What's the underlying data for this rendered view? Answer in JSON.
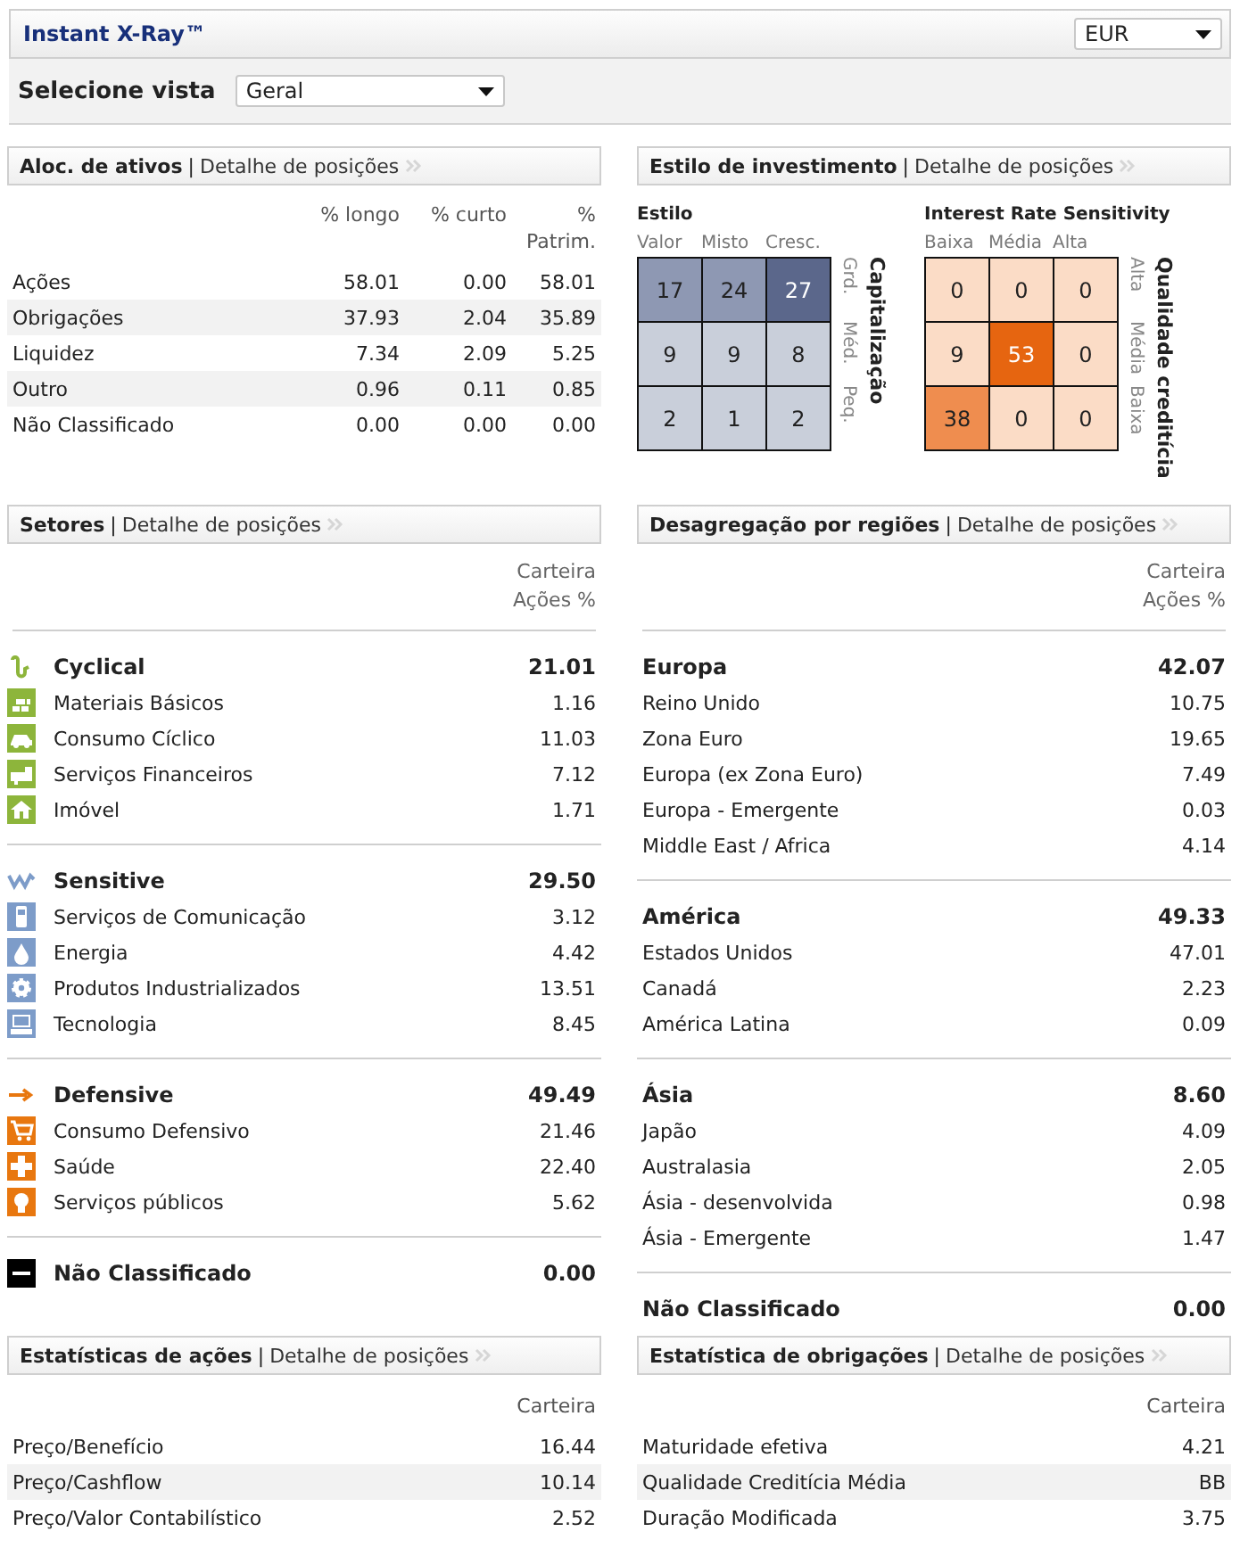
{
  "header": {
    "title": "Instant X-Ray™",
    "currency": "EUR"
  },
  "view": {
    "label": "Selecione vista",
    "value": "Geral"
  },
  "asset_allocation": {
    "title": "Aloc. de ativos",
    "separator": "|",
    "link": "Detalhe de posições",
    "columns": [
      "% longo",
      "% curto",
      "% Patrim."
    ],
    "rows": [
      {
        "name": "Ações",
        "values": [
          "58.01",
          "0.00",
          "58.01"
        ]
      },
      {
        "name": "Obrigações",
        "values": [
          "37.93",
          "2.04",
          "35.89"
        ]
      },
      {
        "name": "Liquidez",
        "values": [
          "7.34",
          "2.09",
          "5.25"
        ]
      },
      {
        "name": "Outro",
        "values": [
          "0.96",
          "0.11",
          "0.85"
        ]
      },
      {
        "name": "Não Classificado",
        "values": [
          "0.00",
          "0.00",
          "0.00"
        ]
      }
    ]
  },
  "investment_style": {
    "title": "Estilo de investimento",
    "separator": "|",
    "link": "Detalhe de posições",
    "boxes": [
      {
        "title": "Estilo",
        "columns": [
          "Valor",
          "Misto",
          "Cresc."
        ],
        "row_labels": [
          "Grd.",
          "Méd.",
          "Peq."
        ],
        "axis": "Capitalização",
        "cells": [
          [
            {
              "value": "17",
              "color": "#8e98b3"
            },
            {
              "value": "24",
              "color": "#8e98b3"
            },
            {
              "value": "27",
              "color": "#5b678b"
            }
          ],
          [
            {
              "value": "9",
              "color": "#c9cfda"
            },
            {
              "value": "9",
              "color": "#c9cfda"
            },
            {
              "value": "8",
              "color": "#c9cfda"
            }
          ],
          [
            {
              "value": "2",
              "color": "#c9cfda"
            },
            {
              "value": "1",
              "color": "#c9cfda"
            },
            {
              "value": "2",
              "color": "#c9cfda"
            }
          ]
        ]
      },
      {
        "title": "Interest Rate Sensitivity",
        "columns": [
          "Baixa",
          "Média",
          "Alta"
        ],
        "row_labels": [
          "Alta",
          "Média",
          "Baixa"
        ],
        "axis": "Qualidade creditícia",
        "cells": [
          [
            {
              "value": "0",
              "color": "#fbdcc6"
            },
            {
              "value": "0",
              "color": "#fbdcc6"
            },
            {
              "value": "0",
              "color": "#fbdcc6"
            }
          ],
          [
            {
              "value": "9",
              "color": "#fbdcc6"
            },
            {
              "value": "53",
              "color": "#e66510"
            },
            {
              "value": "0",
              "color": "#fbdcc6"
            }
          ],
          [
            {
              "value": "38",
              "color": "#ef8d4f"
            },
            {
              "value": "0",
              "color": "#fbdcc6"
            },
            {
              "value": "0",
              "color": "#fbdcc6"
            }
          ]
        ]
      }
    ]
  },
  "sectors": {
    "title": "Setores",
    "separator": "|",
    "link": "Detalhe de posições",
    "column_header": [
      "Carteira",
      "Ações %"
    ],
    "groups": [
      {
        "name": "Cyclical",
        "value": "21.01",
        "color": "#8db53b",
        "items": [
          {
            "name": "Materiais Básicos",
            "value": "1.16"
          },
          {
            "name": "Consumo Cíclico",
            "value": "11.03"
          },
          {
            "name": "Serviços Financeiros",
            "value": "7.12"
          },
          {
            "name": "Imóvel",
            "value": "1.71"
          }
        ]
      },
      {
        "name": "Sensitive",
        "value": "29.50",
        "color": "#7d9cc9",
        "items": [
          {
            "name": "Serviços de Comunicação",
            "value": "3.12"
          },
          {
            "name": "Energia",
            "value": "4.42"
          },
          {
            "name": "Produtos Industrializados",
            "value": "13.51"
          },
          {
            "name": "Tecnologia",
            "value": "8.45"
          }
        ]
      },
      {
        "name": "Defensive",
        "value": "49.49",
        "color": "#e8770f",
        "items": [
          {
            "name": "Consumo Defensivo",
            "value": "21.46"
          },
          {
            "name": "Saúde",
            "value": "22.40"
          },
          {
            "name": "Serviços públicos",
            "value": "5.62"
          }
        ]
      },
      {
        "name": "Não Classificado",
        "value": "0.00",
        "color": "#000000"
      }
    ]
  },
  "regions": {
    "title": "Desagregação por regiões",
    "separator": "|",
    "link": "Detalhe de posições",
    "column_header": [
      "Carteira",
      "Ações %"
    ],
    "groups": [
      {
        "name": "Europa",
        "value": "42.07",
        "items": [
          {
            "name": "Reino Unido",
            "value": "10.75"
          },
          {
            "name": "Zona Euro",
            "value": "19.65"
          },
          {
            "name": "Europa (ex Zona Euro)",
            "value": "7.49"
          },
          {
            "name": "Europa - Emergente",
            "value": "0.03"
          },
          {
            "name": "Middle East / Africa",
            "value": "4.14"
          }
        ]
      },
      {
        "name": "América",
        "value": "49.33",
        "items": [
          {
            "name": "Estados Unidos",
            "value": "47.01"
          },
          {
            "name": "Canadá",
            "value": "2.23"
          },
          {
            "name": "América Latina",
            "value": "0.09"
          }
        ]
      },
      {
        "name": "Ásia",
        "value": "8.60",
        "items": [
          {
            "name": "Japão",
            "value": "4.09"
          },
          {
            "name": "Australasia",
            "value": "2.05"
          },
          {
            "name": "Ásia - desenvolvida",
            "value": "0.98"
          },
          {
            "name": "Ásia - Emergente",
            "value": "1.47"
          }
        ]
      },
      {
        "name": "Não Classificado",
        "value": "0.00"
      }
    ]
  },
  "equity_stats": {
    "title": "Estatísticas de ações",
    "separator": "|",
    "link": "Detalhe de posições",
    "column": "Carteira",
    "rows": [
      {
        "name": "Preço/Benefício",
        "value": "16.44"
      },
      {
        "name": "Preço/Cashflow",
        "value": "10.14"
      },
      {
        "name": "Preço/Valor Contabilístico",
        "value": "2.52"
      }
    ]
  },
  "bond_stats": {
    "title": "Estatística de obrigações",
    "separator": "|",
    "link": "Detalhe de posições",
    "column": "Carteira",
    "rows": [
      {
        "name": "Maturidade efetiva",
        "value": "4.21"
      },
      {
        "name": "Qualidade Creditícia Média",
        "value": "BB"
      },
      {
        "name": "Duração Modificada",
        "value": "3.75"
      }
    ]
  }
}
